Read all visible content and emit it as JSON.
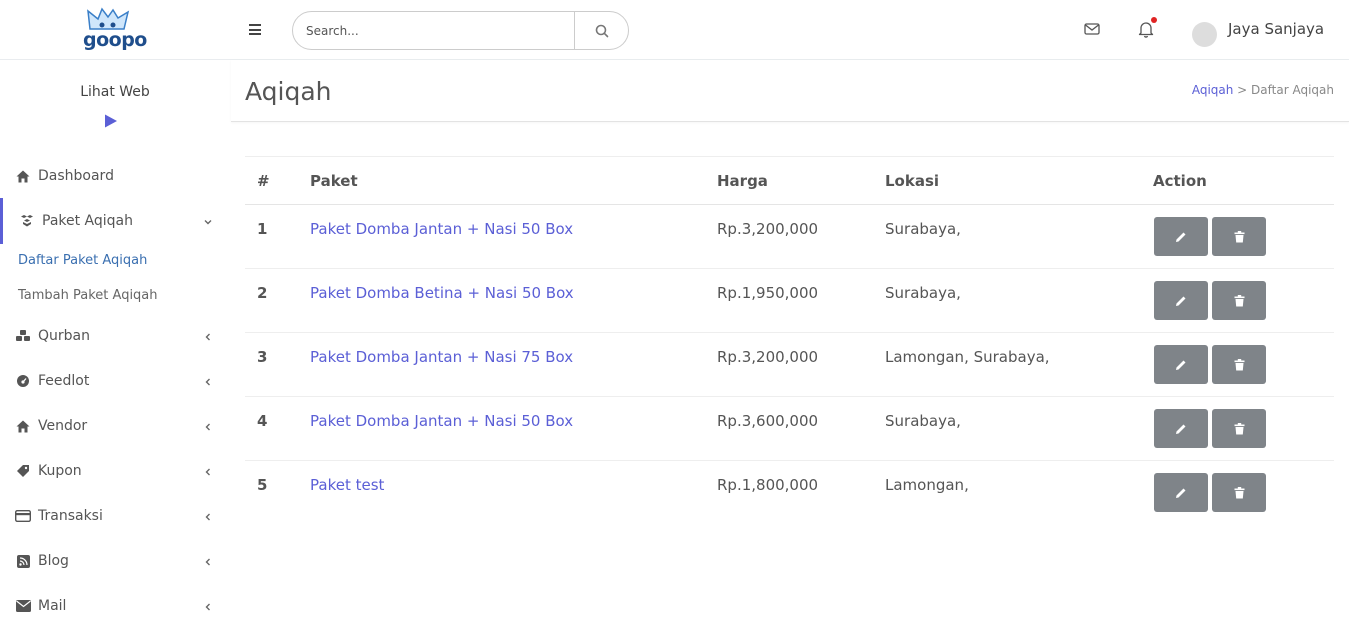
{
  "header": {
    "logo_text": "goopo",
    "search_placeholder": "Search...",
    "user_name": "Jaya Sanjaya"
  },
  "sidebar": {
    "lihat_web": "Lihat Web",
    "items": [
      {
        "label": "Dashboard",
        "icon": "home-icon"
      },
      {
        "label": "Paket Aqiqah",
        "icon": "boxes-icon"
      },
      {
        "label": "Qurban",
        "icon": "cubes-icon"
      },
      {
        "label": "Feedlot",
        "icon": "dashboard-gauge-icon"
      },
      {
        "label": "Vendor",
        "icon": "home-icon"
      },
      {
        "label": "Kupon",
        "icon": "tag-icon"
      },
      {
        "label": "Transaksi",
        "icon": "credit-card-icon"
      },
      {
        "label": "Blog",
        "icon": "rss-icon"
      },
      {
        "label": "Mail",
        "icon": "envelope-icon"
      }
    ],
    "sub_items": [
      {
        "label": "Daftar Paket Aqiqah"
      },
      {
        "label": "Tambah Paket Aqiqah"
      }
    ]
  },
  "page": {
    "title": "Aqiqah",
    "breadcrumb_link": "Aqiqah",
    "breadcrumb_sep": " > ",
    "breadcrumb_current": "Daftar Aqiqah"
  },
  "table": {
    "headers": [
      "#",
      "Paket",
      "Harga",
      "Lokasi",
      "Action"
    ],
    "rows": [
      {
        "num": "1",
        "paket": "Paket Domba Jantan + Nasi 50 Box",
        "harga": "Rp.3,200,000",
        "lokasi": "Surabaya,"
      },
      {
        "num": "2",
        "paket": "Paket Domba Betina + Nasi 50 Box",
        "harga": "Rp.1,950,000",
        "lokasi": "Surabaya,"
      },
      {
        "num": "3",
        "paket": "Paket Domba Jantan + Nasi 75 Box",
        "harga": "Rp.3,200,000",
        "lokasi": "Lamongan, Surabaya,"
      },
      {
        "num": "4",
        "paket": "Paket Domba Jantan + Nasi 50 Box",
        "harga": "Rp.3,600,000",
        "lokasi": "Surabaya,"
      },
      {
        "num": "5",
        "paket": "Paket test",
        "harga": "Rp.1,800,000",
        "lokasi": "Lamongan,"
      }
    ]
  },
  "colors": {
    "accent": "#5b5fd6",
    "action_button": "#7f8489",
    "notification_dot": "#e02424"
  }
}
